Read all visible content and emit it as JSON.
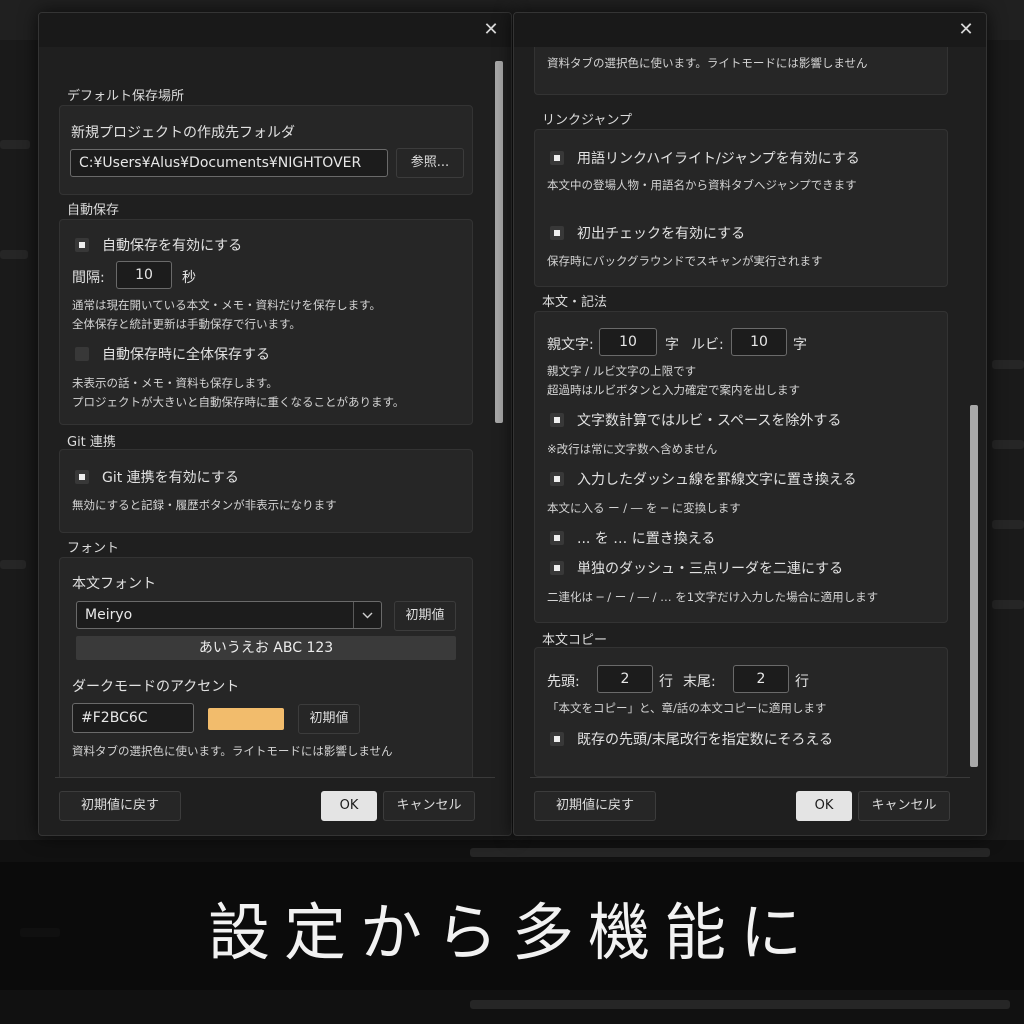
{
  "caption": "設定から多機能に",
  "left_dialog": {
    "close_glyph": "✕",
    "default_location": {
      "section_title": "デフォルト保存場所",
      "folder_label": "新規プロジェクトの作成先フォルダ",
      "folder_value": "C:¥Users¥Alus¥Documents¥NIGHTOVER",
      "browse_button": "参照..."
    },
    "autosave": {
      "section_title": "自動保存",
      "enable_label": "自動保存を有効にする",
      "enable_checked": true,
      "interval_label": "間隔:",
      "interval_value": "10",
      "interval_unit": "秒",
      "note_line1": "通常は現在開いている本文・メモ・資料だけを保存します。",
      "note_line2": "全体保存と統計更新は手動保存で行います。",
      "full_save_label": "自動保存時に全体保存する",
      "full_save_checked": false,
      "full_note_line1": "未表示の話・メモ・資料も保存します。",
      "full_note_line2": "プロジェクトが大きいと自動保存時に重くなることがあります。"
    },
    "git": {
      "section_title": "Git 連携",
      "enable_label": "Git 連携を有効にする",
      "enable_checked": true,
      "note": "無効にすると記録・履歴ボタンが非表示になります"
    },
    "font": {
      "section_title": "フォント",
      "body_font_label": "本文フォント",
      "font_value": "Meiryo",
      "reset_button": "初期値",
      "preview_text": "あいうえお ABC 123",
      "accent_label": "ダークモードのアクセント",
      "accent_value": "#F2BC6C",
      "accent_color": "#F2BC6C",
      "accent_reset_button": "初期値",
      "accent_note": "資料タブの選択色に使います。ライトモードには影響しません"
    },
    "footer": {
      "reset_defaults_button": "初期値に戻す",
      "ok_button": "OK",
      "cancel_button": "キャンセル"
    }
  },
  "right_dialog": {
    "close_glyph": "✕",
    "top_note": "資料タブの選択色に使います。ライトモードには影響しません",
    "link_jump": {
      "section_title": "リンクジャンプ",
      "highlight_label": "用語リンクハイライト/ジャンプを有効にする",
      "highlight_checked": true,
      "highlight_note": "本文中の登場人物・用語名から資料タブへジャンプできます",
      "first_check_label": "初出チェックを有効にする",
      "first_check_checked": true,
      "first_check_note": "保存時にバックグラウンドでスキャンが実行されます"
    },
    "body_notation": {
      "section_title": "本文・記法",
      "parent_label": "親文字:",
      "parent_value": "10",
      "parent_unit": "字",
      "ruby_label": "ルビ:",
      "ruby_value": "10",
      "ruby_unit": "字",
      "limit_note_line1": "親文字 / ルビ文字の上限です",
      "limit_note_line2": "超過時はルビボタンと入力確定で案内を出します",
      "exclude_label": "文字数計算ではルビ・スペースを除外する",
      "exclude_checked": true,
      "exclude_note": "※改行は常に文字数へ含めません",
      "dash_label": "入力したダッシュ線を罫線文字に置き換える",
      "dash_checked": true,
      "dash_note": "本文に入る ー / ― を ─ に変換します",
      "ellipsis_label": "... を … に置き換える",
      "ellipsis_checked": true,
      "double_label": "単独のダッシュ・三点リーダを二連にする",
      "double_checked": true,
      "double_note": "二連化は ─ / ー / ― / … を1文字だけ入力した場合に適用します"
    },
    "body_copy": {
      "section_title": "本文コピー",
      "head_label": "先頭:",
      "head_value": "2",
      "head_unit": "行",
      "tail_label": "末尾:",
      "tail_value": "2",
      "tail_unit": "行",
      "note": "「本文をコピー」と、章/話の本文コピーに適用します",
      "align_label": "既存の先頭/末尾改行を指定数にそろえる",
      "align_checked": true
    },
    "footer": {
      "reset_defaults_button": "初期値に戻す",
      "ok_button": "OK",
      "cancel_button": "キャンセル"
    }
  }
}
